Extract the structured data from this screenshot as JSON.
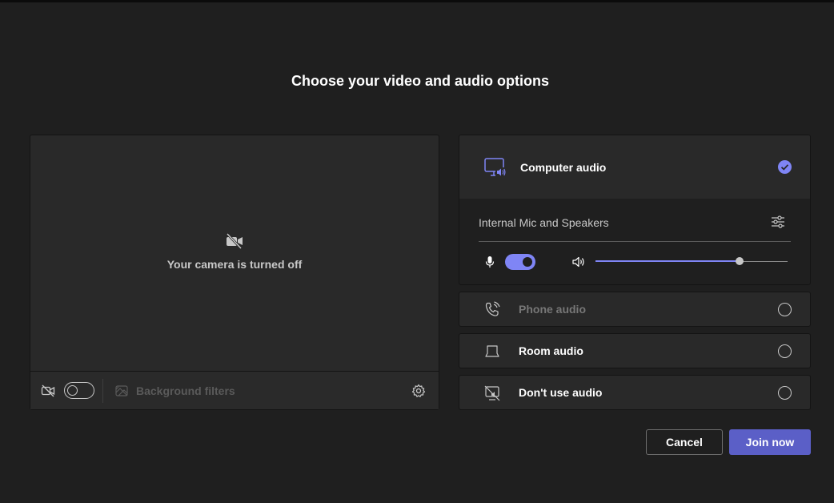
{
  "page": {
    "title": "Choose your video and audio options"
  },
  "video": {
    "camera_off_text": "Your camera is turned off",
    "toolbar": {
      "background_filters_label": "Background filters",
      "camera_toggle_on": false
    }
  },
  "audio": {
    "computer_audio": {
      "label": "Computer audio",
      "selected": true,
      "device": "Internal Mic and Speakers",
      "mic_on": true,
      "volume": 0.75
    },
    "options": [
      {
        "label": "Phone audio",
        "icon": "phone-audio-icon",
        "disabled": true
      },
      {
        "label": "Room audio",
        "icon": "room-audio-icon",
        "disabled": false
      },
      {
        "label": "Don't use audio",
        "icon": "no-audio-icon",
        "disabled": false
      }
    ]
  },
  "actions": {
    "cancel_label": "Cancel",
    "join_label": "Join now"
  },
  "colors": {
    "accent": "#7f85f5",
    "primary_button": "#5b5fc7",
    "background": "#1f1f1f",
    "panel": "#292929"
  }
}
